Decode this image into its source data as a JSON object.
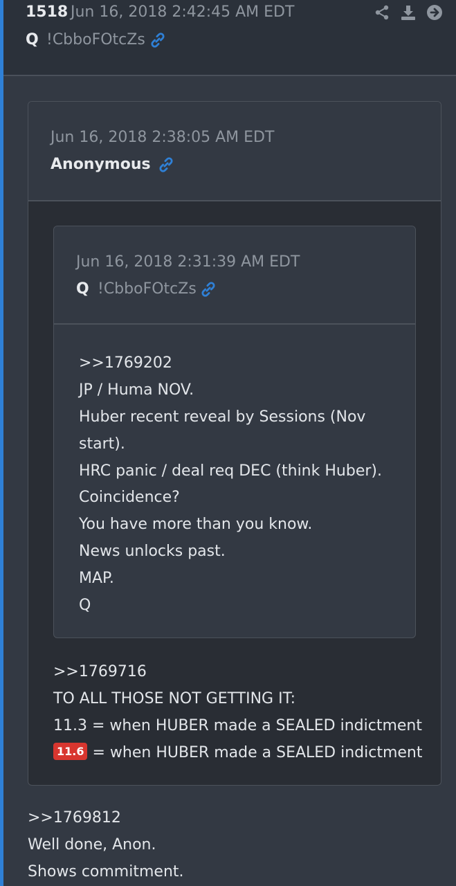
{
  "post": {
    "number": "1518",
    "date": "Jun 16, 2018 2:42:45 AM EDT",
    "author": "Q",
    "tripcode": "!CbboFOtcZs"
  },
  "quote": {
    "date": "Jun 16, 2018 2:38:05 AM EDT",
    "author": "Anonymous",
    "nested": {
      "date": "Jun 16, 2018 2:31:39 AM EDT",
      "author": "Q",
      "tripcode": "!CbboFOtcZs",
      "lines": [
        ">>1769202",
        "JP / Huma NOV.",
        "Huber recent reveal by Sessions (Nov",
        "start).",
        "HRC panic / deal req DEC (think Huber).",
        "Coincidence?",
        "You have more than you know.",
        "News unlocks past.",
        "MAP.",
        "Q"
      ]
    },
    "lines": [
      ">>1769716",
      "TO ALL THOSE NOT GETTING IT:",
      "11.3 = when HUBER made a SEALED indictment"
    ],
    "badge": "11.6",
    "last_line": " = when HUBER made a SEALED indictment"
  },
  "body": {
    "lines": [
      ">>1769812",
      "Well done, Anon.",
      "Shows commitment."
    ]
  },
  "colors": {
    "accent": "#2f80d6",
    "badge": "#d8362f",
    "link": "#2f80d6"
  },
  "icons": [
    "share-icon",
    "download-icon",
    "arrow-circle-right-icon",
    "link-icon"
  ]
}
